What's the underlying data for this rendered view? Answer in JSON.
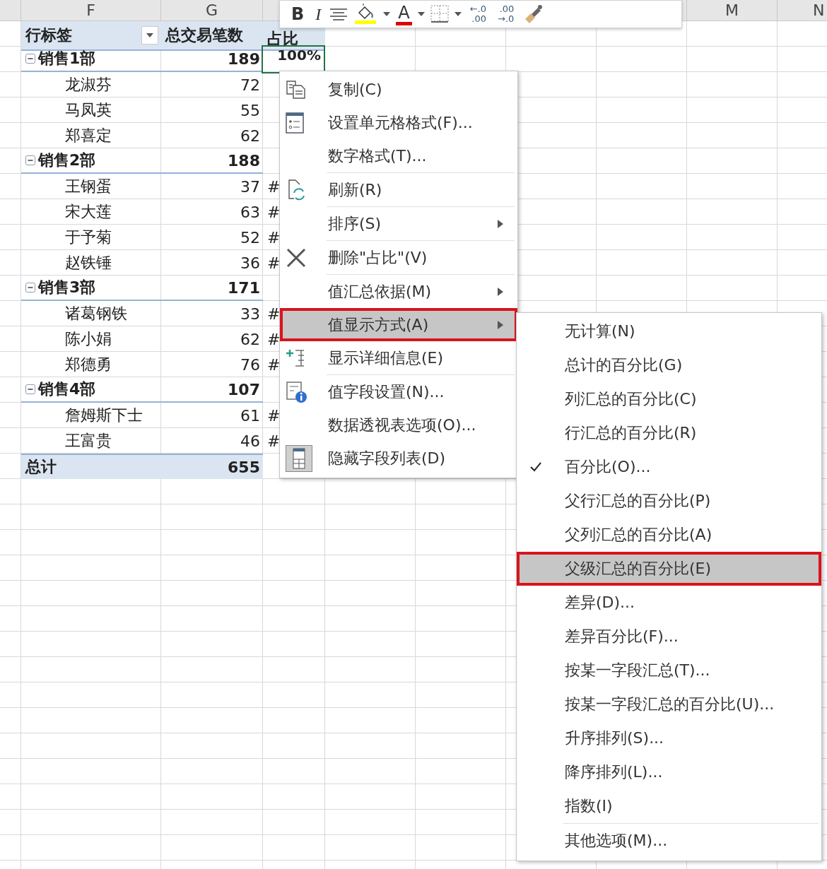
{
  "column_headers": [
    "F",
    "G",
    "M",
    "N"
  ],
  "pivot": {
    "header": {
      "row_label": "行标签",
      "count": "总交易笔数",
      "share": "占比"
    },
    "groups": [
      {
        "label": "销售1部",
        "count": "189",
        "expanded": true,
        "share": {
          "text": "100%",
          "selected": true
        },
        "children": [
          {
            "label": "龙淑芬",
            "count": "72"
          },
          {
            "label": "马凤英",
            "count": "55"
          },
          {
            "label": "郑喜定",
            "count": "62"
          }
        ]
      },
      {
        "label": "销售2部",
        "count": "188",
        "expanded": true,
        "children": [
          {
            "label": "王钢蛋",
            "count": "37",
            "share": {
              "text": "#",
              "selected": false
            }
          },
          {
            "label": "宋大莲",
            "count": "63",
            "share": {
              "text": "#",
              "selected": false
            }
          },
          {
            "label": "于予菊",
            "count": "52",
            "share": {
              "text": "#",
              "selected": false
            }
          },
          {
            "label": "赵铁锤",
            "count": "36",
            "share": {
              "text": "#",
              "selected": false
            }
          }
        ]
      },
      {
        "label": "销售3部",
        "count": "171",
        "expanded": true,
        "children": [
          {
            "label": "诸葛钢铁",
            "count": "33",
            "share": {
              "text": "#",
              "selected": false
            }
          },
          {
            "label": "陈小娟",
            "count": "62",
            "share": {
              "text": "#",
              "selected": false
            }
          },
          {
            "label": "郑德勇",
            "count": "76",
            "share": {
              "text": "#",
              "selected": false
            }
          }
        ]
      },
      {
        "label": "销售4部",
        "count": "107",
        "expanded": true,
        "children": [
          {
            "label": "詹姆斯下士",
            "count": "61",
            "share": {
              "text": "#",
              "selected": false
            }
          },
          {
            "label": "王富贵",
            "count": "46",
            "share": {
              "text": "#",
              "selected": false
            }
          }
        ]
      }
    ],
    "total": {
      "label": "总计",
      "count": "655"
    }
  },
  "toolbar": [
    {
      "kind": "bold",
      "label": "B"
    },
    {
      "kind": "italic",
      "label": "I"
    },
    {
      "kind": "align"
    },
    {
      "kind": "fill",
      "color": "#ffff00"
    },
    {
      "kind": "dropdown"
    },
    {
      "kind": "font-color",
      "label": "A",
      "color": "#e00000"
    },
    {
      "kind": "dropdown"
    },
    {
      "kind": "borders"
    },
    {
      "kind": "dropdown"
    },
    {
      "kind": "increase-decimal",
      "labels": [
        "←.0",
        ".00"
      ]
    },
    {
      "kind": "decrease-decimal",
      "labels": [
        ".00",
        "→.0"
      ]
    },
    {
      "kind": "painter"
    }
  ],
  "context_menu": [
    {
      "kind": "copy",
      "label": "复制(C)",
      "submenu": false,
      "selected": false,
      "divider": false
    },
    {
      "kind": "format",
      "label": "设置单元格格式(F)...",
      "submenu": false,
      "selected": false,
      "divider": false
    },
    {
      "kind": "plain",
      "label": "数字格式(T)...",
      "submenu": false,
      "selected": false,
      "divider": false
    },
    {
      "kind": "refresh",
      "label": "刷新(R)",
      "submenu": false,
      "selected": false,
      "divider": true
    },
    {
      "kind": "plain",
      "label": "排序(S)",
      "submenu": true,
      "selected": false,
      "divider": true
    },
    {
      "kind": "delete",
      "label": "删除\"占比\"(V)",
      "submenu": false,
      "selected": false,
      "divider": true
    },
    {
      "kind": "plain",
      "label": "值汇总依据(M)",
      "submenu": true,
      "selected": false,
      "divider": true
    },
    {
      "kind": "plain",
      "label": "值显示方式(A)",
      "submenu": true,
      "selected": true,
      "divider": false
    },
    {
      "kind": "details",
      "label": "显示详细信息(E)",
      "submenu": false,
      "selected": false,
      "divider": false
    },
    {
      "kind": "field-settings",
      "label": "值字段设置(N)...",
      "submenu": false,
      "selected": false,
      "divider": true
    },
    {
      "kind": "plain",
      "label": "数据透视表选项(O)...",
      "submenu": false,
      "selected": false,
      "divider": false
    },
    {
      "kind": "field-list",
      "label": "隐藏字段列表(D)",
      "submenu": false,
      "selected": false,
      "divider": false
    }
  ],
  "submenu": [
    {
      "label": "无计算(N)",
      "checked": false,
      "selected": false,
      "divider": false
    },
    {
      "label": "总计的百分比(G)",
      "checked": false,
      "selected": false,
      "divider": false
    },
    {
      "label": "列汇总的百分比(C)",
      "checked": false,
      "selected": false,
      "divider": false
    },
    {
      "label": "行汇总的百分比(R)",
      "checked": false,
      "selected": false,
      "divider": false
    },
    {
      "label": "百分比(O)...",
      "checked": true,
      "selected": false,
      "divider": false
    },
    {
      "label": "父行汇总的百分比(P)",
      "checked": false,
      "selected": false,
      "divider": false
    },
    {
      "label": "父列汇总的百分比(A)",
      "checked": false,
      "selected": false,
      "divider": false
    },
    {
      "label": "父级汇总的百分比(E)",
      "checked": false,
      "selected": true,
      "divider": false
    },
    {
      "label": "差异(D)...",
      "checked": false,
      "selected": false,
      "divider": false
    },
    {
      "label": "差异百分比(F)...",
      "checked": false,
      "selected": false,
      "divider": false
    },
    {
      "label": "按某一字段汇总(T)...",
      "checked": false,
      "selected": false,
      "divider": false
    },
    {
      "label": "按某一字段汇总的百分比(U)...",
      "checked": false,
      "selected": false,
      "divider": false
    },
    {
      "label": "升序排列(S)...",
      "checked": false,
      "selected": false,
      "divider": false
    },
    {
      "label": "降序排列(L)...",
      "checked": false,
      "selected": false,
      "divider": false
    },
    {
      "label": "指数(I)",
      "checked": false,
      "selected": false,
      "divider": false
    },
    {
      "label": "其他选项(M)...",
      "checked": false,
      "selected": false,
      "divider": true
    }
  ]
}
